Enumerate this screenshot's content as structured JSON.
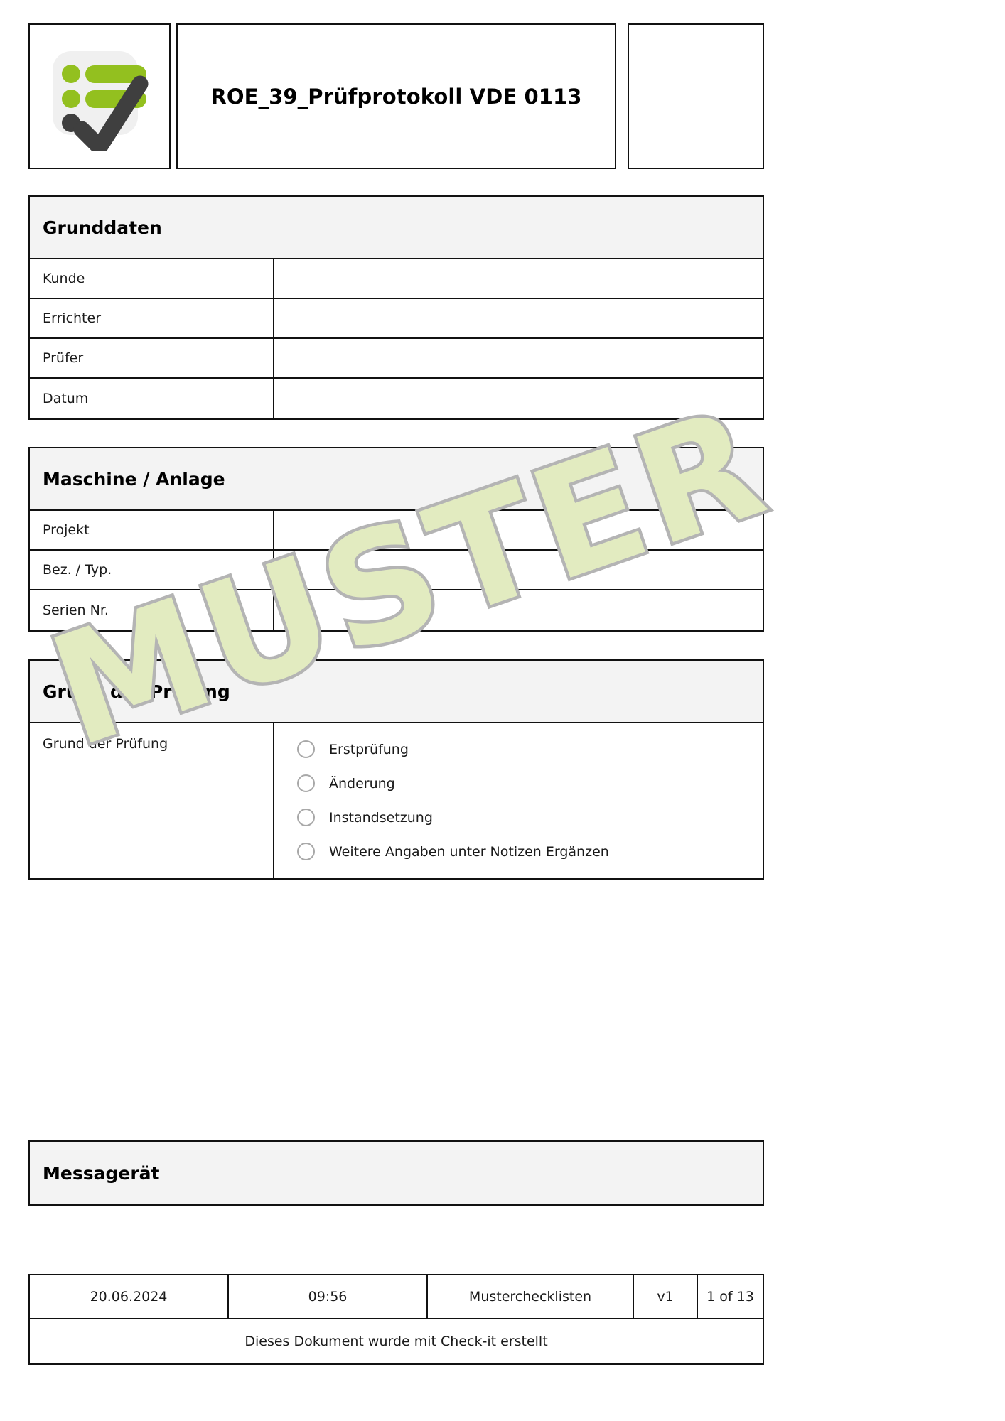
{
  "document": {
    "title": "ROE_39_Prüfprotokoll VDE 0113",
    "watermark_text": "MUSTER",
    "logo_icon": "checklist-check-logo"
  },
  "colors": {
    "logo_green": "#93c01f",
    "logo_dark": "#3f3f3f",
    "watermark_outline": "#b4b4b4",
    "watermark_fill": "#e2ebc0",
    "section_header_bg": "#f3f3f3",
    "border": "#111111"
  },
  "sections": [
    {
      "id": "grunddaten",
      "header": "Grunddaten",
      "rows": [
        {
          "label": "Kunde",
          "value": ""
        },
        {
          "label": "Errichter",
          "value": ""
        },
        {
          "label": "Prüfer",
          "value": ""
        },
        {
          "label": "Datum",
          "value": ""
        }
      ]
    },
    {
      "id": "maschine-anlage",
      "header": "Maschine / Anlage",
      "rows": [
        {
          "label": "Projekt",
          "value": ""
        },
        {
          "label": "Bez. / Typ.",
          "value": ""
        },
        {
          "label": "Serien Nr.",
          "value": ""
        }
      ]
    },
    {
      "id": "grund-der-pruefung",
      "header": "Grund der Prüfung",
      "rows": [
        {
          "label": "Grund der Prüfung",
          "value": ""
        }
      ],
      "options": [
        {
          "label": "Erstprüfung",
          "checked": false
        },
        {
          "label": "Änderung",
          "checked": false
        },
        {
          "label": "Instandsetzung",
          "checked": false
        },
        {
          "label": "Weitere Angaben unter Notizen Ergänzen",
          "checked": false
        }
      ]
    },
    {
      "id": "messageraet",
      "header": "Messagerät",
      "rows": []
    }
  ],
  "footer": {
    "date": "20.06.2024",
    "time": "09:56",
    "collection": "Musterchecklisten",
    "version": "v1",
    "page": "1 of 13",
    "note": "Dieses Dokument wurde mit Check-it erstellt"
  }
}
